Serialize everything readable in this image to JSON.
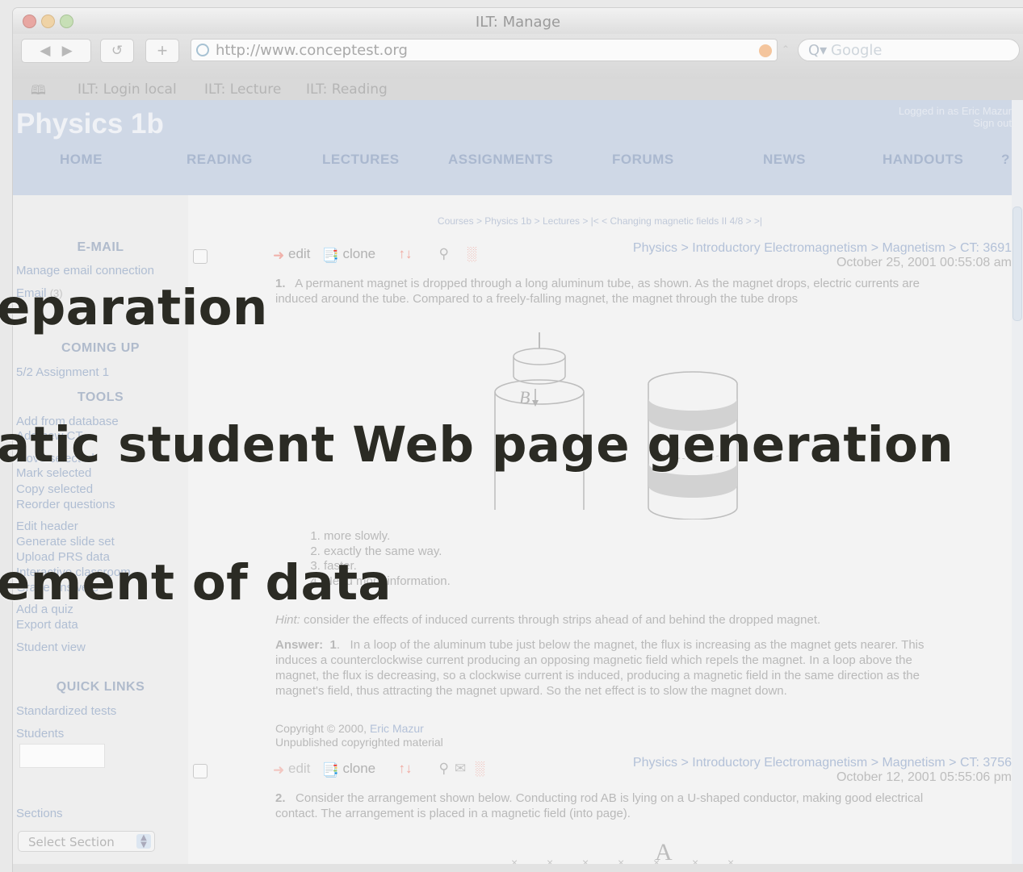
{
  "window": {
    "title": "ILT: Manage"
  },
  "toolbar": {
    "back_icon": "back-arrow-icon",
    "reload_symbol": "↺",
    "add_symbol": "+",
    "url": "http://www.conceptest.org",
    "search_placeholder": "Google",
    "search_prefix": "Q▾"
  },
  "bookmarks": [
    "ILT: Login local",
    "ILT: Lecture",
    "ILT: Reading"
  ],
  "site": {
    "brand": "Physics 1b",
    "login_line1": "Logged in as Eric Mazur",
    "login_line2": "Sign out",
    "nav": [
      "HOME",
      "READING",
      "LECTURES",
      "ASSIGNMENTS",
      "FORUMS",
      "NEWS",
      "HANDOUTS",
      "?"
    ]
  },
  "sidebar": {
    "email_heading": "E-MAIL",
    "manage_email": "Manage email connection",
    "email_label": "Email",
    "email_count": "(3)",
    "coming_up_heading": "COMING UP",
    "assignment": "5/2 Assignment 1",
    "tools_heading": "TOOLS",
    "tools": [
      "Add from database",
      "Add new CT",
      "Move selected",
      "Mark selected",
      "Copy selected",
      "Reorder questions"
    ],
    "tools2": [
      "Edit header",
      "Generate slide set",
      "Upload PRS data",
      "Interactive classroom",
      "Grade answers",
      "Add a quiz",
      "Export data"
    ],
    "student_view": "Student view",
    "quick_links_heading": "QUICK LINKS",
    "quick_links": [
      "Standardized tests",
      "Students"
    ],
    "sections_label": "Sections",
    "select_section": "Select Section"
  },
  "main": {
    "breadcrumb": "Courses > Physics 1b > Lectures > |<  <  Changing magnetic fields II 4/8  >  >|",
    "edit_label": "edit",
    "clone_label": "clone",
    "q1": {
      "path": "Physics > Introductory Electromagnetism > Magnetism > CT: 3691",
      "date": "October 25, 2001  00:55:08 am",
      "number": "1.",
      "text": "A permanent magnet is dropped through a long aluminum tube, as shown. As the magnet drops, electric currents are induced around the tube. Compared to a freely-falling magnet, the magnet through the tube drops",
      "figure_label": "B",
      "choices": [
        "more slowly.",
        "exactly the same way.",
        "faster.",
        "Need more information."
      ],
      "hint_label": "Hint:",
      "hint": "consider the effects of induced currents through strips ahead of and behind the dropped magnet.",
      "answer_label": "Answer:",
      "answer_num": "1",
      "answer": "In a loop of the aluminum tube just below the magnet, the flux is increasing as the magnet gets nearer. This induces a counterclockwise current producing an opposing magnetic field which repels the magnet. In a loop above the magnet, the flux is decreasing, so a clockwise current is induced, producing a magnetic field in the same direction as the magnet's field, thus attracting the magnet upward. So the net effect is to slow the magnet down.",
      "copyright": "Copyright © 2000,",
      "copyright_author": "Eric Mazur",
      "unpublished": "Unpublished copyrighted material"
    },
    "q2": {
      "path": "Physics > Introductory Electromagnetism > Magnetism > CT: 3756",
      "date": "October 12, 2001  05:55:06 pm",
      "number": "2.",
      "text": "Consider the arrangement shown below. Conducting rod AB is lying on a U-shaped conductor, making good electrical contact. The arrangement is placed in a magnetic field (into page).",
      "figure_label": "A"
    }
  },
  "overlay": {
    "line1": "eparation",
    "line2": "atic student Web page generation",
    "line3": "ement of data"
  }
}
